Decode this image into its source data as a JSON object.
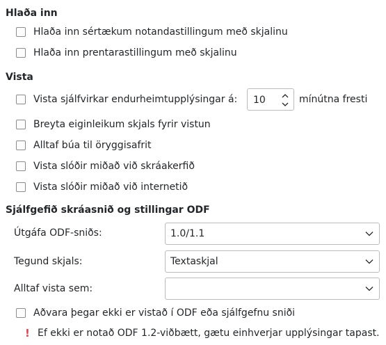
{
  "load": {
    "heading": "Hlaða inn",
    "items": [
      {
        "label": "Hlaða inn sértækum notandastillingum með skjalinu",
        "checked": false
      },
      {
        "label": "Hlaða inn prentarastillingum með skjalinu",
        "checked": false
      }
    ]
  },
  "save": {
    "heading": "Vista",
    "autorecovery": {
      "label": "Vista sjálfvirkar endurheimtupplýsingar á:",
      "checked": false,
      "value": "10",
      "unit": "mínútna fresti"
    },
    "items": [
      {
        "label": "Breyta eiginleikum skjals fyrir vistun",
        "checked": false
      },
      {
        "label": "Alltaf búa til öryggisafrit",
        "checked": false
      },
      {
        "label": "Vista slóðir miðað við skráakerfið",
        "checked": false
      },
      {
        "label": "Vista slóðir miðað við internetið",
        "checked": false
      }
    ]
  },
  "odf": {
    "heading": "Sjálfgefið skráasnið og stillingar ODF",
    "version": {
      "label": "Útgáfa ODF-sniðs:",
      "value": "1.0/1.1"
    },
    "doctype": {
      "label": "Tegund skjals:",
      "value": "Textaskjal"
    },
    "always_save_as": {
      "label": "Alltaf vista sem:",
      "value": ""
    },
    "warn": {
      "label": "Aðvara þegar ekki er vistað í ODF eða sjálfgefnu sniði",
      "checked": false
    },
    "warning_icon": "exclamation-icon",
    "warning_text": "Ef ekki er notað ODF 1.2-viðbætt, gætu einhverjar upplýsingar tapast."
  },
  "colors": {
    "warning": "#da4453",
    "text": "#232629",
    "border": "#b9bcbf"
  }
}
